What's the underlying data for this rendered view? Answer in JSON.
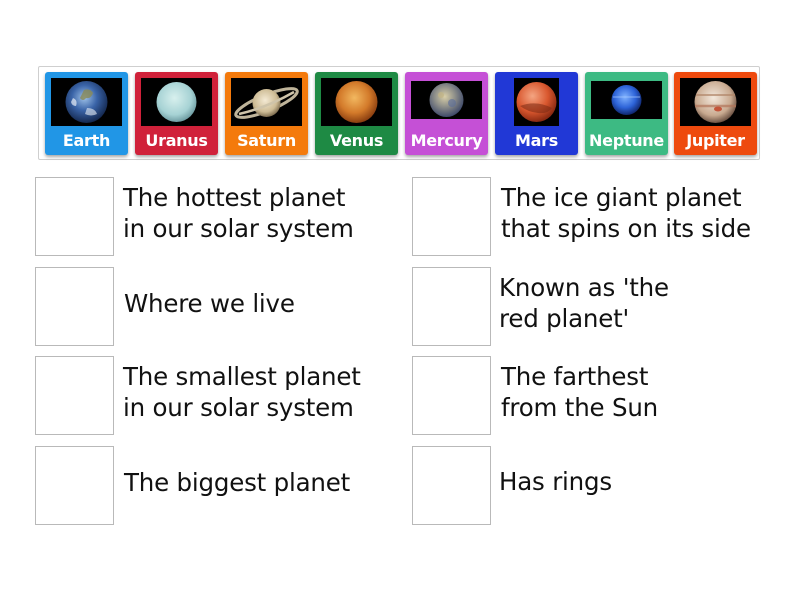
{
  "cards": [
    {
      "label": "Earth",
      "color": "#2196e6",
      "icon": "earth-icon"
    },
    {
      "label": "Uranus",
      "color": "#d0213a",
      "icon": "uranus-icon"
    },
    {
      "label": "Saturn",
      "color": "#f47a0c",
      "icon": "saturn-icon"
    },
    {
      "label": "Venus",
      "color": "#1e8a44",
      "icon": "venus-icon"
    },
    {
      "label": "Mercury",
      "color": "#c550d6",
      "icon": "mercury-icon"
    },
    {
      "label": "Mars",
      "color": "#2138d6",
      "icon": "mars-icon"
    },
    {
      "label": "Neptune",
      "color": "#3dba83",
      "icon": "neptune-icon"
    },
    {
      "label": "Jupiter",
      "color": "#ee4a0e",
      "icon": "jupiter-icon"
    }
  ],
  "clues": {
    "left": [
      {
        "line1": "The hottest planet",
        "line2": "in our solar system"
      },
      {
        "line1": "Where we live",
        "line2": ""
      },
      {
        "line1": "The smallest planet",
        "line2": "in our solar system"
      },
      {
        "line1": "The biggest planet",
        "line2": ""
      }
    ],
    "right": [
      {
        "line1": "The ice giant planet",
        "line2": "that spins on its side"
      },
      {
        "line1": "Known as 'the",
        "line2": "red planet'"
      },
      {
        "line1": "The farthest",
        "line2": "from the Sun"
      },
      {
        "line1": "Has rings",
        "line2": ""
      }
    ]
  }
}
